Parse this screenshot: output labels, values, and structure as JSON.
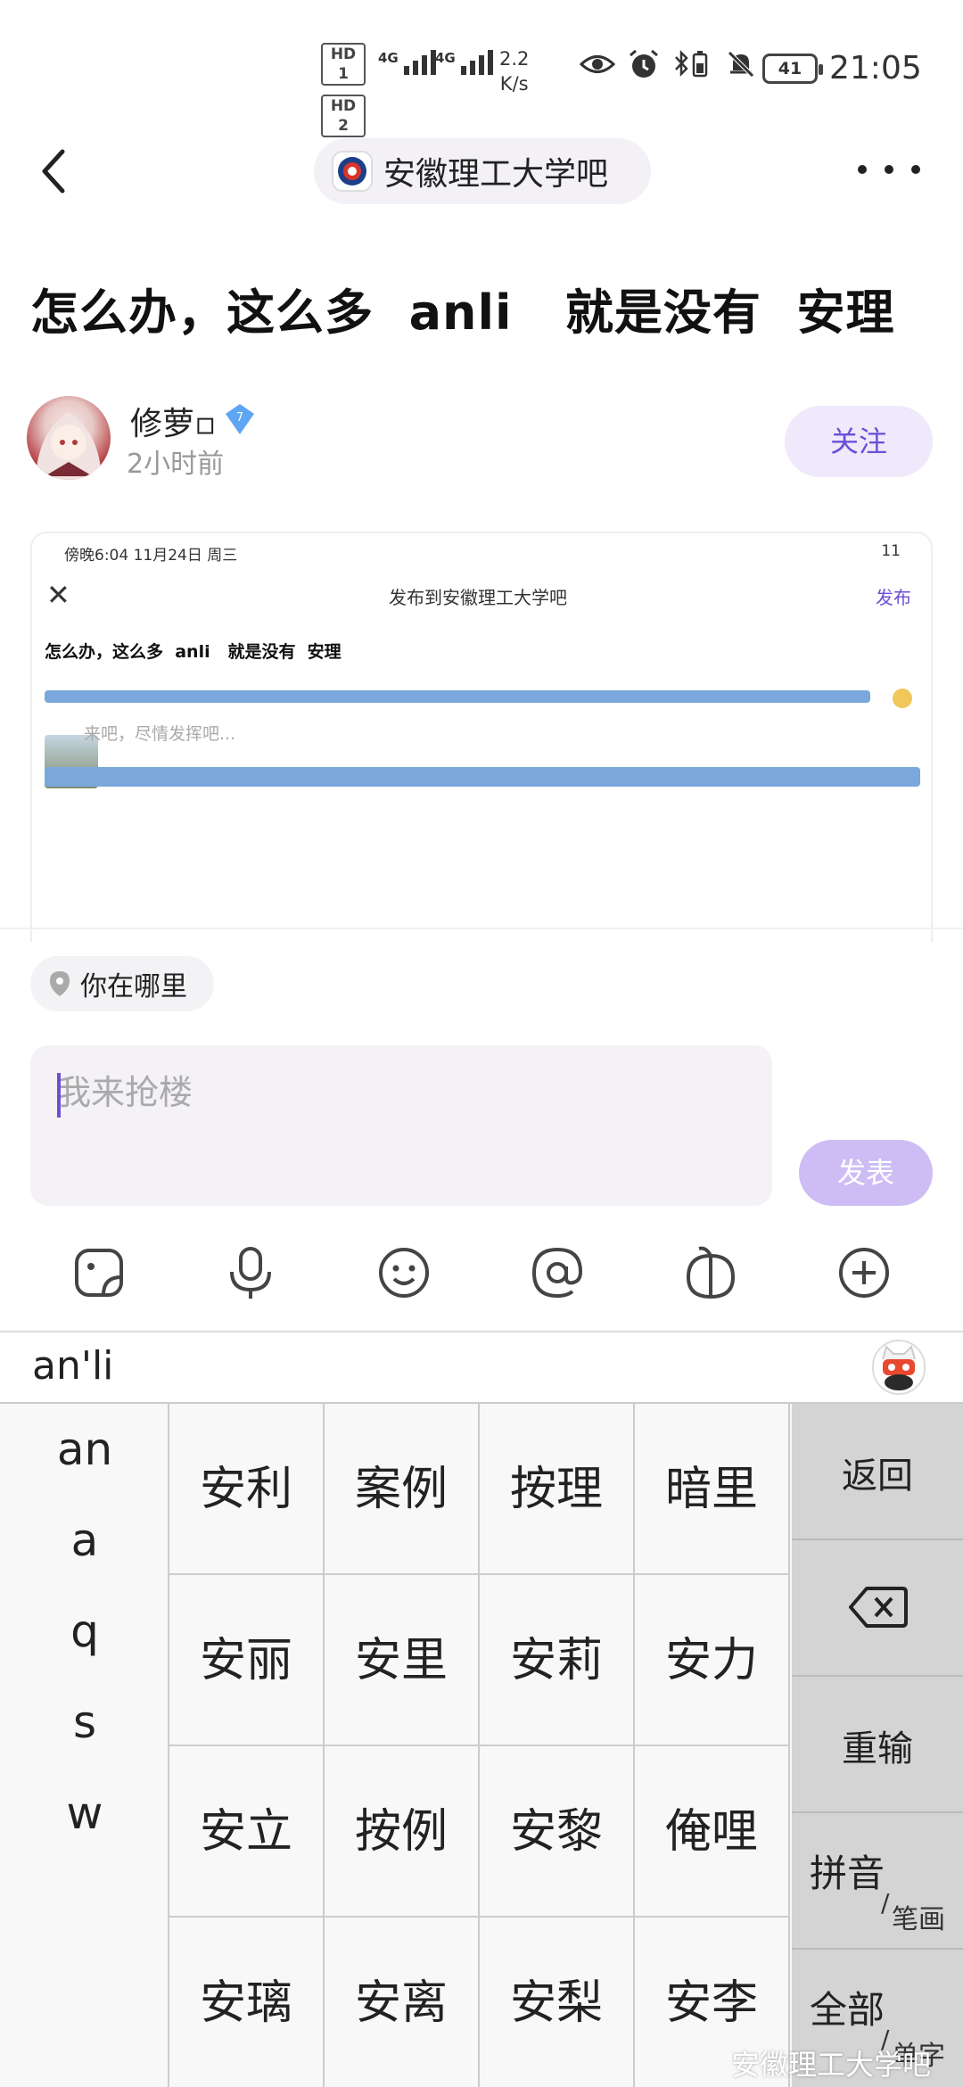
{
  "status_bar": {
    "hd1": "HD 1",
    "hd2": "HD 2",
    "net1": "4G",
    "net2": "4G",
    "speed_value": "2.2",
    "speed_unit": "K/s",
    "battery": "41",
    "time": "21:05"
  },
  "header": {
    "forum_name": "安徽理工大学吧"
  },
  "post": {
    "title": "怎么办，这么多  anli   就是没有  安理",
    "author": "修萝▫",
    "level": "7",
    "time": "2小时前",
    "follow_label": "关注"
  },
  "embedded_screenshot": {
    "status_left": "傍晚6:04  11月24日 周三",
    "status_right": "11",
    "close_glyph": "✕",
    "title": "发布到安徽理工大学吧",
    "publish": "发布",
    "post_title": "怎么办，这么多  anli   就是没有  安理",
    "placeholder": "来吧，尽情发挥吧..."
  },
  "composer": {
    "location_label": "你在哪里",
    "placeholder": "我来抢楼",
    "publish_label": "发表"
  },
  "keyboard": {
    "composition": "an'li",
    "left_keys": [
      "an",
      "a",
      "q",
      "s",
      "w"
    ],
    "candidates": [
      "安利",
      "案例",
      "按理",
      "暗里",
      "安丽",
      "安里",
      "安莉",
      "安力",
      "安立",
      "按例",
      "安黎",
      "俺哩",
      "安璃",
      "安离",
      "安梨",
      "安李"
    ],
    "right": {
      "return": "返回",
      "reinput": "重输",
      "pinyin_main": "拼音",
      "pinyin_sub": "笔画",
      "all_main": "全部",
      "all_sub": "单字",
      "slash": "/"
    }
  },
  "watermark": "安徽理工大学吧",
  "colors": {
    "accent": "#6b4fd6",
    "publish_disabled": "#cdbdf4",
    "follow_bg": "#efe9fb",
    "input_bg": "#f4f1f7"
  }
}
